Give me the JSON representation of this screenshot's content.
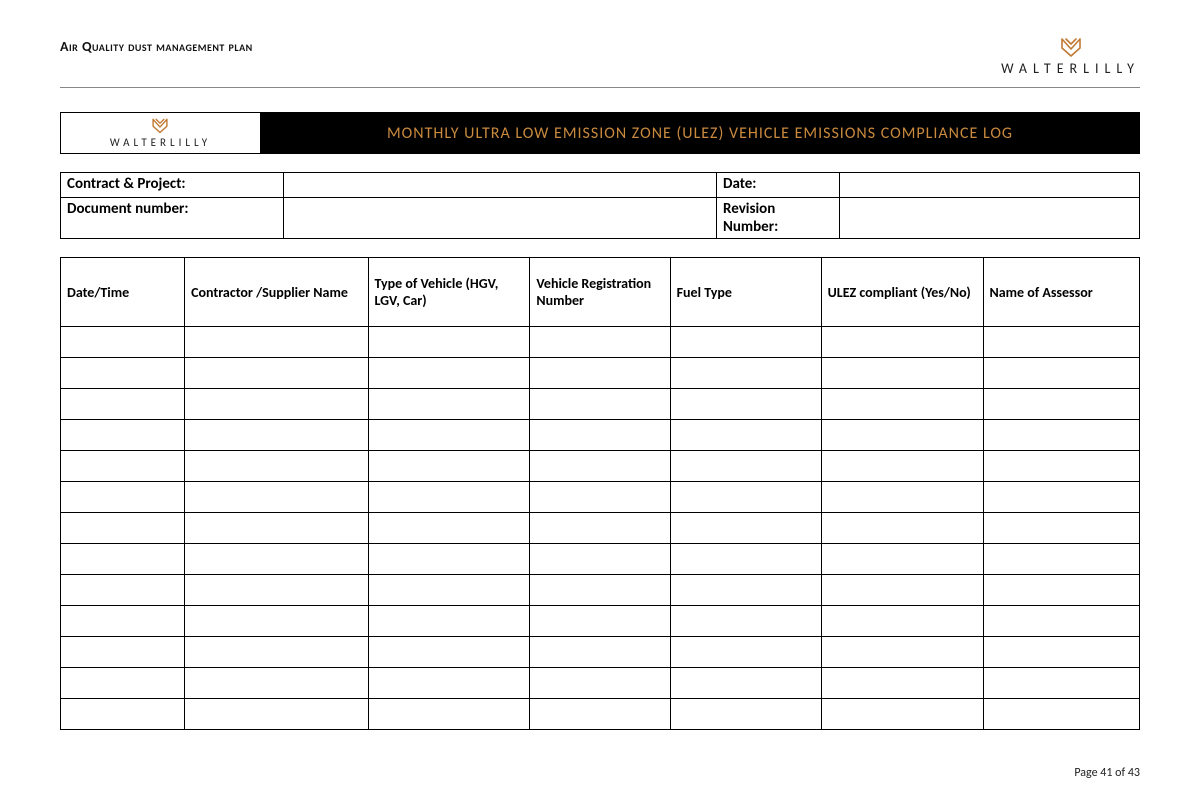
{
  "header": {
    "doc_title": "Air Quality dust management plan",
    "brand_name": "WALTERLILLY"
  },
  "banner": {
    "title": "MONTHLY ULTRA LOW EMISSION ZONE (ULEZ) VEHICLE EMISSIONS COMPLIANCE LOG"
  },
  "meta": {
    "contract_project_label": "Contract & Project:",
    "contract_project_value": "",
    "document_number_label": "Document number:",
    "document_number_value": "",
    "date_label": "Date:",
    "date_value": "",
    "revision_number_label": "Revision Number:",
    "revision_number_value": ""
  },
  "log": {
    "columns": [
      "Date/Time",
      "Contractor /Supplier Name",
      "Type of Vehicle (HGV, LGV, Car)",
      "Vehicle Registration Number",
      "Fuel Type",
      "ULEZ compliant (Yes/No)",
      "Name of Assessor"
    ],
    "empty_rows": 13,
    "col_widths_pct": [
      11.5,
      17,
      15,
      13,
      14,
      15,
      14.5
    ]
  },
  "footer": {
    "page_text": "Page 41 of 43"
  }
}
